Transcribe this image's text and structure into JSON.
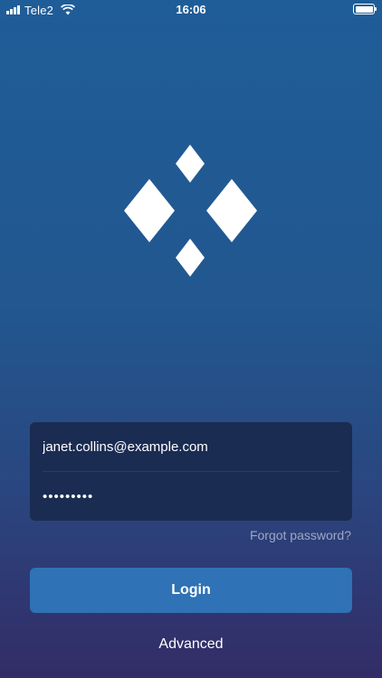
{
  "status_bar": {
    "carrier": "Tele2",
    "time": "16:06",
    "signal_icon": "signal-bars-icon",
    "wifi_icon": "wifi-icon",
    "battery_icon": "battery-icon",
    "battery_level": 1.0
  },
  "logo": {
    "icon": "diamond-logo-icon",
    "color": "#ffffff"
  },
  "login_form": {
    "email_value": "janet.collins@example.com",
    "password_value": "•••••••••"
  },
  "forgot_password": {
    "label": "Forgot password?"
  },
  "login_button": {
    "label": "Login"
  },
  "advanced_link": {
    "label": "Advanced"
  },
  "colors": {
    "background_top": "#1f5d98",
    "background_bottom": "#332c66",
    "card": "#1a2c52",
    "button": "#2f72b5",
    "muted_text": "#9ea7c4"
  }
}
